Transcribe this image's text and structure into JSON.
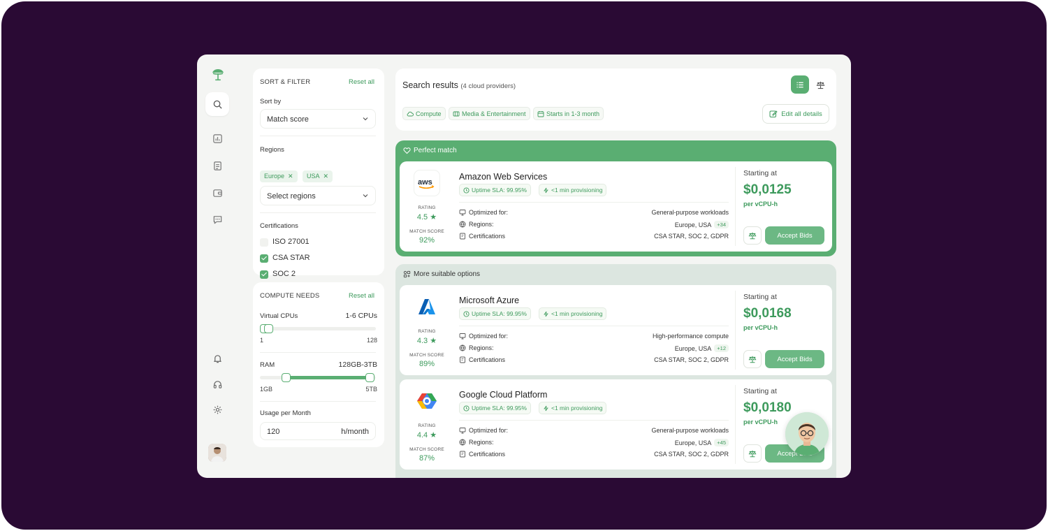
{
  "nav": {
    "items": [
      "logo-tree",
      "search",
      "reports",
      "documents",
      "wallet",
      "messages",
      "notifications",
      "support",
      "settings",
      "user-avatar"
    ]
  },
  "filters": {
    "title": "SORT & FILTER",
    "reset_label": "Reset all",
    "sort_by_label": "Sort by",
    "sort_by_value": "Match score",
    "regions_label": "Regions",
    "region_tags": [
      "Europe",
      "USA"
    ],
    "regions_placeholder": "Select regions",
    "certifications_label": "Certifications",
    "certifications": [
      {
        "label": "ISO 27001",
        "checked": false
      },
      {
        "label": "CSA STAR",
        "checked": true
      },
      {
        "label": "SOC 2",
        "checked": true
      }
    ]
  },
  "compute": {
    "title": "COMPUTE NEEDS",
    "reset_label": "Reset all",
    "vcpu_label": "Virtual CPUs",
    "vcpu_value": "1-6 CPUs",
    "vcpu_min": "1",
    "vcpu_max": "128",
    "ram_label": "RAM",
    "ram_value": "128GB-3TB",
    "ram_min": "1GB",
    "ram_max": "5TB",
    "usage_label": "Usage per Month",
    "usage_value": "120",
    "usage_unit": "h/month"
  },
  "results": {
    "title": "Search results",
    "count": "(4 cloud providers)",
    "chips": [
      "Compute",
      "Media & Entertainment",
      "Starts in 1-3 month"
    ],
    "edit_label": "Edit all details",
    "perfect_label": "Perfect match",
    "more_label": "More suitable options"
  },
  "providers": [
    {
      "name": "Amazon Web Services",
      "logo": "aws-logo",
      "uptime": "Uptime SLA: 99.95%",
      "provisioning": "<1 min provisioning",
      "rating_label": "RATING",
      "rating": "4.5",
      "match_label": "MATCH SCORE",
      "match": "92%",
      "optimized_label": "Optimized for:",
      "optimized": "General-purpose workloads",
      "regions_label": "Regions:",
      "regions": "Europe, USA",
      "regions_extra": "+34",
      "cert_label": "Certifications",
      "certs": "CSA STAR, SOC 2, GDPR",
      "starting_label": "Starting at",
      "price": "$0,0125",
      "unit": "per vCPU-h",
      "accept_label": "Accept Bids"
    },
    {
      "name": "Microsoft Azure",
      "logo": "azure-logo",
      "uptime": "Uptime SLA: 99.95%",
      "provisioning": "<1 min provisioning",
      "rating_label": "RATING",
      "rating": "4.3",
      "match_label": "MATCH SCORE",
      "match": "89%",
      "optimized_label": "Optimized for:",
      "optimized": "High-performance compute",
      "regions_label": "Regions:",
      "regions": "Europe, USA",
      "regions_extra": "+12",
      "cert_label": "Certifications",
      "certs": "CSA STAR, SOC 2, GDPR",
      "starting_label": "Starting at",
      "price": "$0,0168",
      "unit": "per vCPU-h",
      "accept_label": "Accept Bids"
    },
    {
      "name": "Google Cloud Platform",
      "logo": "gcp-logo",
      "uptime": "Uptime SLA: 99.95%",
      "provisioning": "<1 min provisioning",
      "rating_label": "RATING",
      "rating": "4.4",
      "match_label": "MATCH SCORE",
      "match": "87%",
      "optimized_label": "Optimized for:",
      "optimized": "General-purpose workloads",
      "regions_label": "Regions:",
      "regions": "Europe, USA",
      "regions_extra": "+45",
      "cert_label": "Certifications",
      "certs": "CSA STAR, SOC 2, GDPR",
      "starting_label": "Starting at",
      "price": "$0,0180",
      "unit": "per vCPU-h",
      "accept_label": "Accept Bids"
    }
  ],
  "sliders": {
    "vcpu_range_fraction": [
      0.0,
      0.04
    ],
    "ram_range_fraction": [
      0.2,
      0.99
    ]
  },
  "colors": {
    "frame": "#2a0a34",
    "accent": "#5aae72",
    "accent_text": "#3d9a5c",
    "app_bg": "#f4f5f3"
  }
}
